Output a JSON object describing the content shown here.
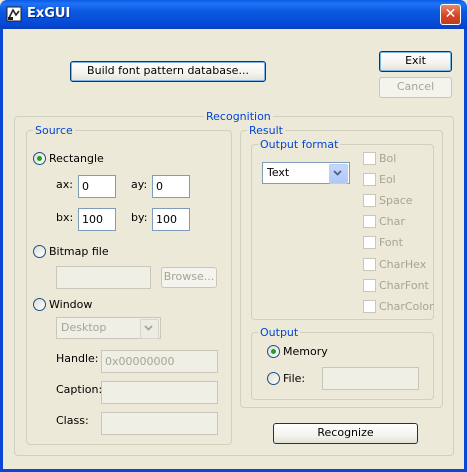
{
  "window": {
    "title": "ExGUI",
    "close_glyph": "✕"
  },
  "buttons": {
    "build": "Build font pattern database...",
    "exit": "Exit",
    "cancel": "Cancel",
    "recognize": "Recognize"
  },
  "recognition": {
    "title": "Recognition",
    "source": {
      "title": "Source",
      "rectangle": {
        "label": "Rectangle",
        "ax_label": "ax:",
        "ax": "0",
        "ay_label": "ay:",
        "ay": "0",
        "bx_label": "bx:",
        "bx": "100",
        "by_label": "by:",
        "by": "100"
      },
      "bitmap": {
        "label": "Bitmap file",
        "value": "",
        "browse": "Browse..."
      },
      "window": {
        "label": "Window",
        "select_value": "Desktop",
        "handle_label": "Handle:",
        "handle": "0x00000000",
        "caption_label": "Caption:",
        "caption": "",
        "class_label": "Class:",
        "class": ""
      }
    },
    "result": {
      "title": "Result",
      "output_format": {
        "title": "Output format",
        "select_value": "Text",
        "options": [
          "Bol",
          "Eol",
          "Space",
          "Char",
          "Font",
          "CharHex",
          "CharFont",
          "CharColor"
        ]
      },
      "output": {
        "title": "Output",
        "memory": "Memory",
        "file": "File:",
        "file_value": ""
      }
    }
  },
  "colors": {
    "titlebar": "#0A5AE4",
    "dialog_bg": "#ECE9D8",
    "group_label": "#0046D5",
    "radio_dot": "#21A121"
  }
}
